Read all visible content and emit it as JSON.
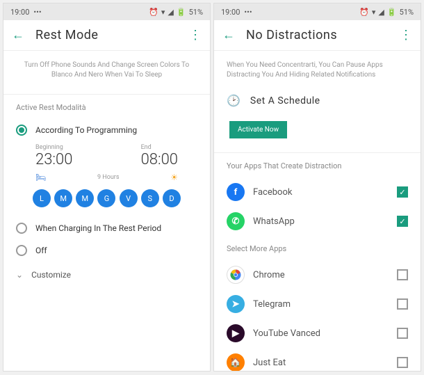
{
  "status": {
    "time": "19:00",
    "battery": "51%"
  },
  "left": {
    "title": "Rest Mode",
    "desc": "Turn Off Phone Sounds And Change Screen Colors To Blanco And Nero When Vai To Sleep",
    "section_active": "Active Rest Modalità",
    "radio_programming": "According To Programming",
    "time_begin_label": "Beginning",
    "time_begin": "23:00",
    "time_end_label": "End",
    "time_end": "08:00",
    "duration": "9 Hours",
    "days": [
      "L",
      "M",
      "M",
      "G",
      "V",
      "S",
      "D"
    ],
    "radio_charging": "When Charging In The Rest Period",
    "radio_off": "Off",
    "customize": "Customize"
  },
  "right": {
    "title": "No Distractions",
    "desc": "When You Need Concentrarti, You Can Pause Apps Distracting You And Hiding Related Notifications",
    "set_schedule": "Set A Schedule",
    "activate": "Activate Now",
    "section_distracting": "Your Apps That Create Distraction",
    "section_more": "Select More Apps",
    "apps": {
      "facebook": "Facebook",
      "whatsapp": "WhatsApp",
      "chrome": "Chrome",
      "telegram": "Telegram",
      "youtube": "YouTube Vanced",
      "justeat": "Just Eat"
    }
  }
}
